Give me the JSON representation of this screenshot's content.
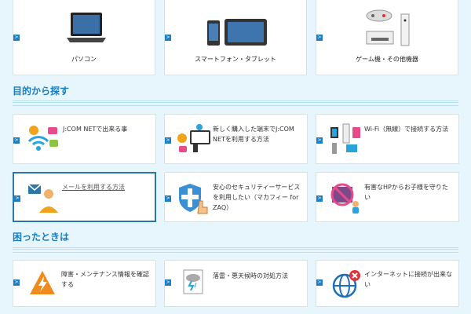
{
  "devices": [
    {
      "label": "パソコン",
      "icon": "laptop-icon"
    },
    {
      "label": "スマートフォン・タブレット",
      "icon": "phone-tablet-icon"
    },
    {
      "label": "ゲーム機・その他機器",
      "icon": "game-console-icon"
    }
  ],
  "purpose": {
    "heading": "目的から探す",
    "items": [
      {
        "label": "J:COM NETで出来る事",
        "icon": "services-icon"
      },
      {
        "label": "新しく購入した端末でJ:COM NETを利用する方法",
        "icon": "new-device-icon"
      },
      {
        "label": "Wi-Fi（無線）で接続する方法",
        "icon": "wifi-router-icon"
      },
      {
        "label": "メールを利用する方法",
        "icon": "mail-user-icon"
      },
      {
        "label": "安心のセキュリティーサービスを利用したい（マカフィー for ZAQ）",
        "icon": "security-shield-icon"
      },
      {
        "label": "有害なHPからお子様を守りたい",
        "icon": "parental-control-icon"
      }
    ]
  },
  "trouble": {
    "heading": "困ったときは",
    "items": [
      {
        "label": "障害・メンテナンス情報を確認する",
        "icon": "warning-lightning-icon"
      },
      {
        "label": "落雷・悪天候時の対処方法",
        "icon": "storm-document-icon"
      },
      {
        "label": "インターネットに接続が出来ない",
        "icon": "globe-error-icon"
      }
    ]
  },
  "colors": {
    "accent": "#1a7dc4",
    "background": "#e6f6fc"
  }
}
